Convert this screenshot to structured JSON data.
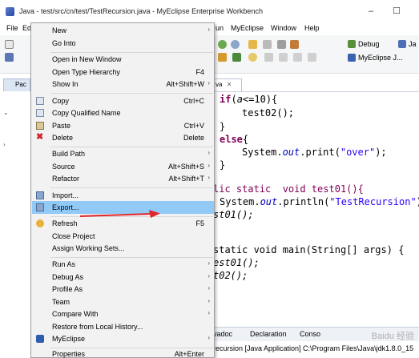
{
  "window": {
    "title": "Java - test/src/cn/test/TestRecursion.java - MyEclipse Enterprise Workbench",
    "minimize_glyph": "–",
    "maximize_glyph": "☐"
  },
  "menubar": {
    "items": [
      "File",
      "Ed",
      "un",
      "MyEclipse",
      "Window",
      "Help"
    ]
  },
  "toolbar": {
    "perspectives": [
      {
        "label": "Debug",
        "icon": "bug-icon"
      },
      {
        "label": "Ja",
        "icon": "java-perspective-icon"
      },
      {
        "label": "MyEclipse J...",
        "icon": "myeclipse-perspective-icon"
      }
    ]
  },
  "left_panel": {
    "tab_label": "Pac"
  },
  "editor": {
    "tab_label": "va",
    "tab_close": "✕",
    "lines": [
      {
        "text": "if(",
        "var": "a",
        "rest": "<=10){"
      },
      {
        "text": "test02();"
      },
      {
        "text": "}"
      },
      {
        "kw": "else",
        "rest": "{"
      },
      {
        "pre": "System.",
        "fld": "out",
        "post": ".print(",
        "str": "\"over\"",
        "end": ");"
      },
      {
        "text": "}"
      },
      {
        "text": "lic static  void test01(){"
      },
      {
        "pre": "System.",
        "fld": "out",
        "post": ".println(",
        "str": "\"TestRecursion\"",
        "end": ")"
      },
      {
        "text": "st01();"
      },
      {
        "text": "static void main(String[] args) {"
      },
      {
        "text": "est01();"
      },
      {
        "text": "t02();"
      }
    ]
  },
  "bottom": {
    "tabs": [
      "vadoc",
      "Declaration",
      "Conso"
    ],
    "console_text": "recursion [Java Application] C:\\Program Files\\Java\\jdk1.8.0_15"
  },
  "context_menu": {
    "items": [
      {
        "label": "New",
        "shortcut": "",
        "submenu": true
      },
      {
        "label": "Go Into",
        "shortcut": "",
        "submenu": false
      },
      {
        "label": "Open in New Window",
        "shortcut": "",
        "submenu": false
      },
      {
        "label": "Open Type Hierarchy",
        "shortcut": "F4",
        "submenu": false
      },
      {
        "label": "Show In",
        "shortcut": "Alt+Shift+W",
        "submenu": true
      },
      {
        "label": "Copy",
        "shortcut": "Ctrl+C",
        "submenu": false
      },
      {
        "label": "Copy Qualified Name",
        "shortcut": "",
        "submenu": false
      },
      {
        "label": "Paste",
        "shortcut": "Ctrl+V",
        "submenu": false
      },
      {
        "label": "Delete",
        "shortcut": "Delete",
        "submenu": false
      },
      {
        "label": "Build Path",
        "shortcut": "",
        "submenu": true
      },
      {
        "label": "Source",
        "shortcut": "Alt+Shift+S",
        "submenu": true
      },
      {
        "label": "Refactor",
        "shortcut": "Alt+Shift+T",
        "submenu": true
      },
      {
        "label": "Import...",
        "shortcut": "",
        "submenu": false
      },
      {
        "label": "Export...",
        "shortcut": "",
        "submenu": false
      },
      {
        "label": "Refresh",
        "shortcut": "F5",
        "submenu": false
      },
      {
        "label": "Close Project",
        "shortcut": "",
        "submenu": false
      },
      {
        "label": "Assign Working Sets...",
        "shortcut": "",
        "submenu": false
      },
      {
        "label": "Run As",
        "shortcut": "",
        "submenu": true
      },
      {
        "label": "Debug As",
        "shortcut": "",
        "submenu": true
      },
      {
        "label": "Profile As",
        "shortcut": "",
        "submenu": true
      },
      {
        "label": "Team",
        "shortcut": "",
        "submenu": true
      },
      {
        "label": "Compare With",
        "shortcut": "",
        "submenu": true
      },
      {
        "label": "Restore from Local History...",
        "shortcut": "",
        "submenu": false
      },
      {
        "label": "MyEclipse",
        "shortcut": "",
        "submenu": true
      },
      {
        "label": "Properties",
        "shortcut": "Alt+Enter",
        "submenu": false
      }
    ],
    "highlighted": "Export...",
    "submenu_glyph": "›"
  },
  "watermark": {
    "text": "Baidu 经验"
  },
  "colors": {
    "menu_highlight": "#91c9f7",
    "annotation_arrow": "#e0262b",
    "keyword": "#7f0055",
    "string": "#2a00ff",
    "field": "#0000c0"
  }
}
